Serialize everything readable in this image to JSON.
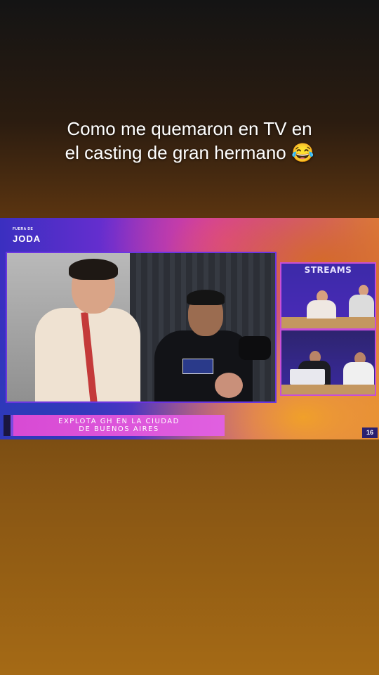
{
  "caption": {
    "line1": "Como me quemaron en TV en",
    "line2": "el casting de gran hermano 😂"
  },
  "broadcast": {
    "logo_small": "FUERA DE",
    "logo_main": "JODA",
    "streams_label": "STREAMS",
    "lower_third_line1": "EXPLOTA GH EN LA CIUDAD",
    "lower_third_line2": "DE BUENOS AIRES",
    "corner_number": "16"
  },
  "colors": {
    "frame_border": "#6a36e0",
    "lower_third": "#d84ad4"
  }
}
